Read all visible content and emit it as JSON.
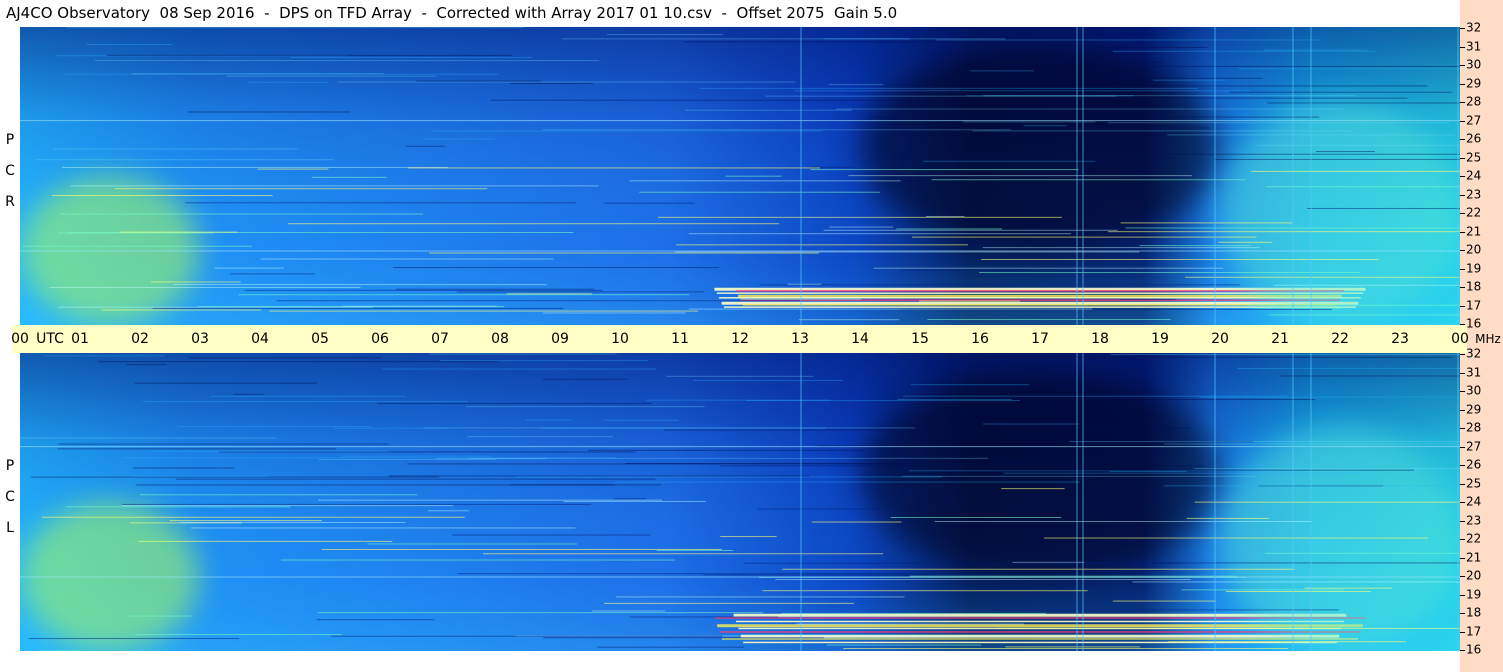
{
  "title": "AJ4CO Observatory  08 Sep 2016  -  DPS on TFD Array  -  Corrected with Array 2017 01 10.csv  -  Offset 2075  Gain 5.0",
  "panels": [
    {
      "label": [
        "R",
        "C",
        "P"
      ]
    },
    {
      "label": [
        "L",
        "C",
        "P"
      ]
    }
  ],
  "time_axis": {
    "unit_label": "UTC",
    "ticks": [
      "00",
      "01",
      "02",
      "03",
      "04",
      "05",
      "06",
      "07",
      "08",
      "09",
      "10",
      "11",
      "12",
      "13",
      "14",
      "15",
      "16",
      "17",
      "18",
      "19",
      "20",
      "21",
      "22",
      "23",
      "00"
    ]
  },
  "freq_axis": {
    "unit_label": "MHz",
    "ticks": [
      "32",
      "31",
      "30",
      "29",
      "28",
      "27",
      "26",
      "25",
      "24",
      "23",
      "22",
      "21",
      "20",
      "19",
      "18",
      "17",
      "16"
    ]
  },
  "colors": {
    "background_band": "#1f6fe8",
    "quiet_band": "#00a8ff",
    "dark_band": "#000a3a",
    "hot_band": "#ffff40",
    "timebar": "#ffffc6",
    "freq_axis_bg": "#ffdcc5"
  },
  "chart_data": [
    {
      "type": "heatmap",
      "polarization": "RCP",
      "x_range_utc_hours": [
        0,
        24
      ],
      "y_range_mhz": [
        16,
        32
      ],
      "features": [
        {
          "utc_start": 0,
          "utc_end": 3,
          "description_color": "green-yellow",
          "mhz": [
            16,
            24
          ]
        },
        {
          "utc_start": 14,
          "utc_end": 20,
          "description_color": "dark-navy",
          "mhz": [
            20,
            31
          ]
        },
        {
          "utc_start": 11.5,
          "utc_end": 22.5,
          "description_color": "white-yellow-streak",
          "mhz": [
            17,
            18
          ]
        },
        {
          "utc_start": 20,
          "utc_end": 24,
          "description_color": "cyan-green",
          "mhz": [
            16,
            28
          ]
        }
      ]
    },
    {
      "type": "heatmap",
      "polarization": "LCP",
      "x_range_utc_hours": [
        0,
        24
      ],
      "y_range_mhz": [
        16,
        32
      ],
      "features": [
        {
          "utc_start": 0,
          "utc_end": 3,
          "description_color": "green-yellow",
          "mhz": [
            16,
            24
          ]
        },
        {
          "utc_start": 14,
          "utc_end": 20,
          "description_color": "dark-navy",
          "mhz": [
            20,
            31
          ]
        },
        {
          "utc_start": 11.5,
          "utc_end": 22.5,
          "description_color": "white-yellow-streak",
          "mhz": [
            16.5,
            18
          ]
        },
        {
          "utc_start": 20,
          "utc_end": 24,
          "description_color": "cyan-green",
          "mhz": [
            16,
            28
          ]
        }
      ]
    }
  ]
}
